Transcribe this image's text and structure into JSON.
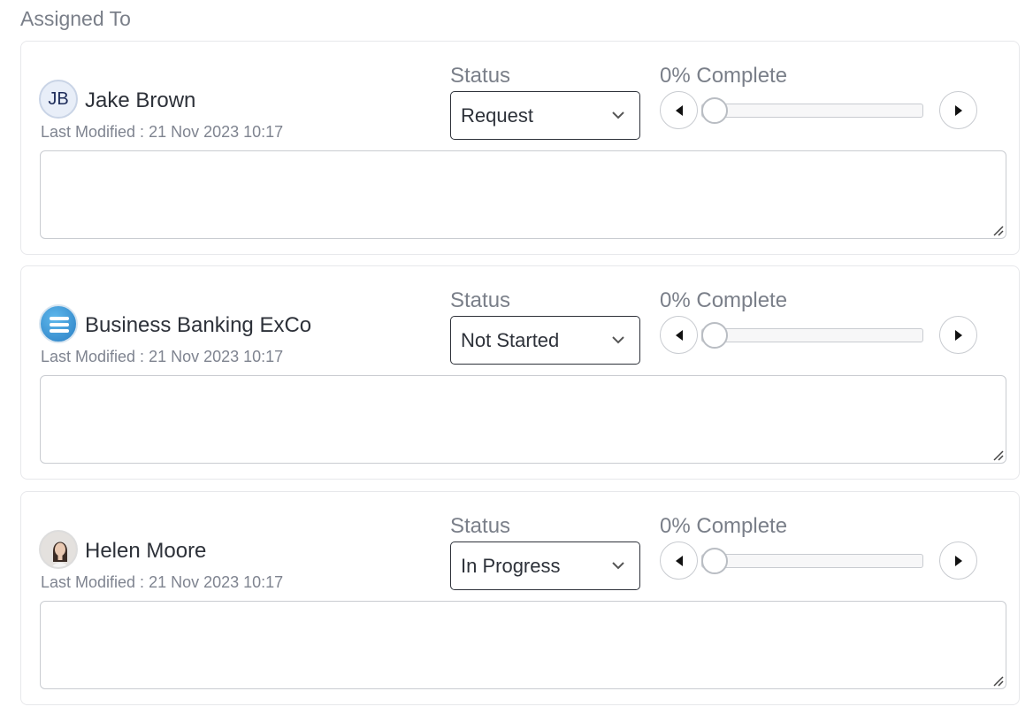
{
  "section_title": "Assigned To",
  "assignees": [
    {
      "name": "Jake Brown",
      "avatar": {
        "type": "initials",
        "initials": "JB"
      },
      "last_modified": "Last Modified : 21 Nov 2023 10:17",
      "status_label": "Status",
      "status": "Request",
      "progress_label": "0% Complete",
      "progress": 0,
      "notes": ""
    },
    {
      "name": "Business Banking ExCo",
      "avatar": {
        "type": "group-icon"
      },
      "last_modified": "Last Modified : 21 Nov 2023 10:17",
      "status_label": "Status",
      "status": "Not Started",
      "progress_label": "0% Complete",
      "progress": 0,
      "notes": ""
    },
    {
      "name": "Helen Moore",
      "avatar": {
        "type": "photo"
      },
      "last_modified": "Last Modified : 21 Nov 2023 10:17",
      "status_label": "Status",
      "status": "In Progress",
      "progress_label": "0% Complete",
      "progress": 0,
      "notes": ""
    }
  ],
  "icons": {
    "prev": "caret-left-icon",
    "next": "caret-right-icon",
    "dropdown": "chevron-down-icon",
    "resize": "resize-handle-icon"
  }
}
